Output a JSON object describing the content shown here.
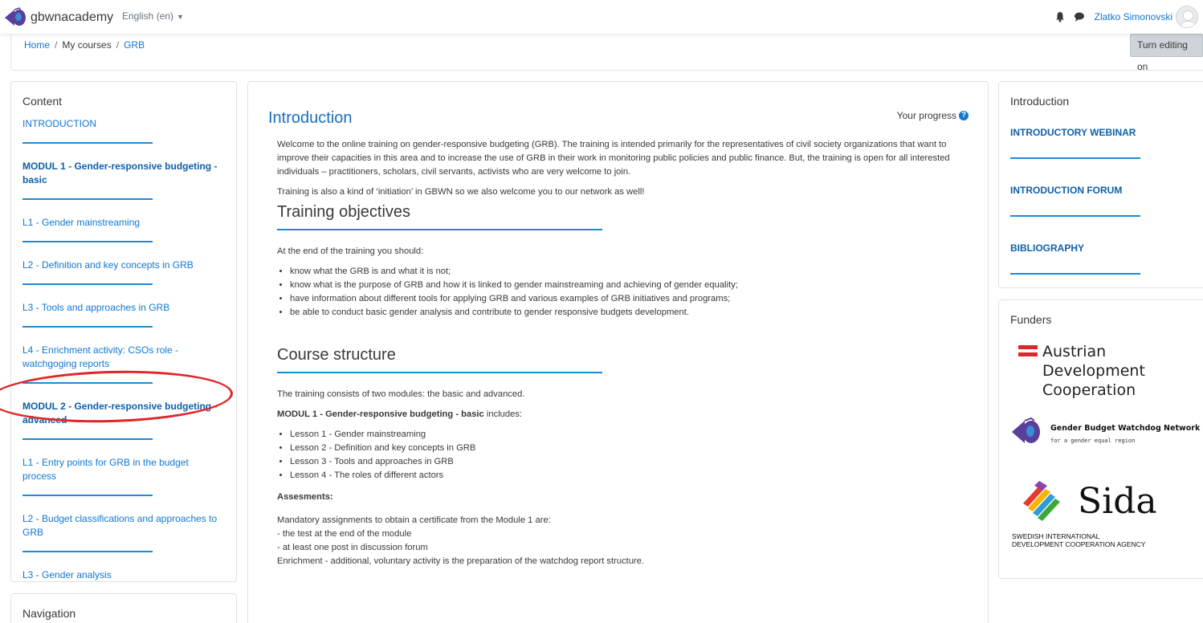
{
  "navbar": {
    "brand": "gbwnacademy",
    "language": "English (en)",
    "user_name": "Zlatko Simonovski"
  },
  "header": {
    "breadcrumb": [
      "Home",
      "My courses",
      "GRB"
    ],
    "edit_button": "Turn editing on"
  },
  "left_block": {
    "title": "Content",
    "items": [
      {
        "label": "INTRODUCTION",
        "bold": false
      },
      {
        "label": "MODUL 1 - Gender-responsive budgeting - basic",
        "bold": true
      },
      {
        "label": "L1 - Gender mainstreaming",
        "bold": false
      },
      {
        "label": "L2 - Definition and key concepts in  GRB",
        "bold": false
      },
      {
        "label": "L3 - Tools and approaches in GRB",
        "bold": false
      },
      {
        "label": "L4 - Enrichment activity: CSOs role - watchgoging reports",
        "bold": false
      },
      {
        "label": "MODUL 2 - Gender-responsive budgeting - advanced",
        "bold": true
      },
      {
        "label": "L1 - Entry points for GRB in the budget process",
        "bold": false
      },
      {
        "label": "L2 - Budget classifications and approaches to GRB",
        "bold": false
      },
      {
        "label": "L3 - Gender analysis",
        "bold": false
      }
    ]
  },
  "navigation_block": {
    "title": "Navigation"
  },
  "main": {
    "heading": "Introduction",
    "progress_label": "Your progress",
    "intro_p1": "Welcome to the online training on gender-responsive budgeting (GRB). The training is intended primarily for the representatives of civil society organizations that want to improve their capacities in this area and to increase the use of GRB in their work in monitoring public policies and public finance. But, the training is open for all interested individuals – practitioners, scholars, civil servants, activists who are very welcome to join.",
    "intro_p2": "Training is also a kind of ‘initiation’ in GBWN so we also welcome you to our network as well!",
    "objectives_heading": "Training objectives",
    "objectives_intro": "At the end of the training you should:",
    "objectives": [
      "know what the GRB is and what it is not;",
      "know what is the purpose of GRB and how it is linked to gender mainstreaming  and achieving of gender equality;",
      "have information about different tools for applying GRB and various examples of GRB initiatives and programs;",
      "be able to conduct basic gender analysis and contribute to gender responsive budgets development."
    ],
    "structure_heading": "Course structure",
    "structure_intro": "The training consists of two modules: the basic and advanced.",
    "modul1_bold": "MODUL 1 - Gender-responsive budgeting - basic",
    "modul1_rest": "  includes:",
    "lessons": [
      "Lesson 1 - Gender mainstreaming",
      "Lesson 2 - Definition and key concepts in  GRB",
      "Lesson 3 - Tools and approaches in GRB",
      "Lesson 4 - The roles of different actors"
    ],
    "assessments_heading": "Assesments:",
    "assess_lines": [
      "Mandatory assignments to obtain a certificate from the Module 1 are:",
      "- the test at the end of the module",
      "- at least one post in discussion forum",
      "Enrichment - additional, voluntary activity is the preparation of the watchdog report structure."
    ]
  },
  "right_intro": {
    "title": "Introduction",
    "links": [
      "INTRODUCTORY WEBINAR",
      "INTRODUCTION FORUM",
      "BIBLIOGRAPHY"
    ]
  },
  "funders": {
    "title": "Funders",
    "ada": [
      "Austrian",
      "Development",
      "Cooperation"
    ],
    "gbwn_name": "Gender Budget Watchdog Network",
    "gbwn_tagline": "for a gender equal region",
    "sida_name": "Sida",
    "sida_line1": "SWEDISH INTERNATIONAL",
    "sida_line2": "DEVELOPMENT COOPERATION AGENCY"
  },
  "colors": {
    "link": "#1177d1",
    "heading_blue": "#1a6fbd",
    "rule_blue": "#1a8bd8",
    "annotation_red": "#e0262b"
  }
}
